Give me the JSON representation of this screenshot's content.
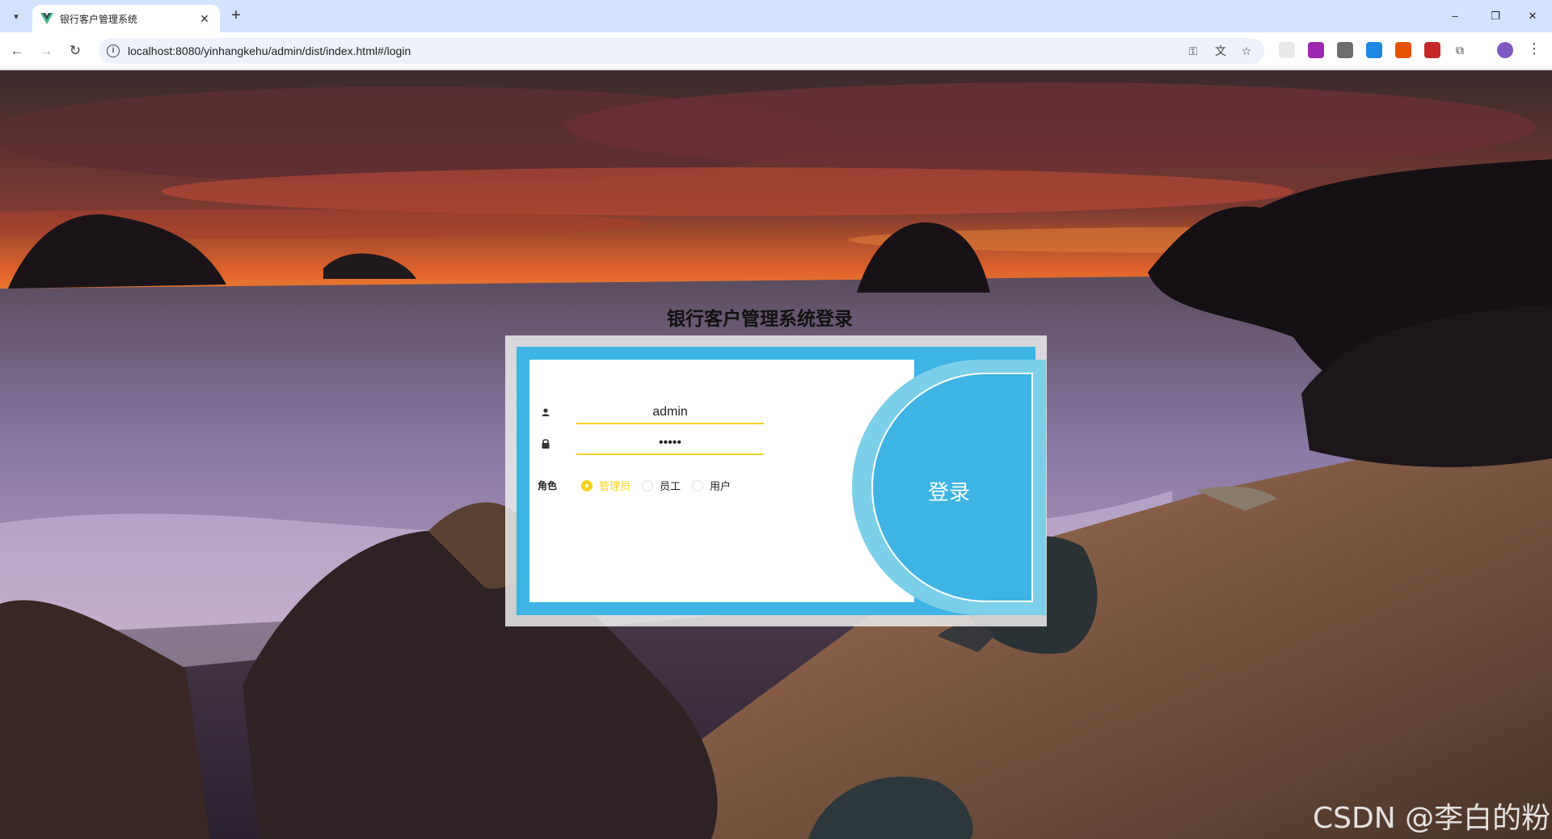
{
  "browser": {
    "tab_title": "银行客户管理系统",
    "url": "localhost:8080/yinhangkehu/admin/dist/index.html#/login",
    "minimize": "–",
    "restore": "❐",
    "close": "✕",
    "new_tab": "+",
    "tab_close": "✕",
    "back": "←",
    "forward": "→",
    "reload": "↻",
    "info": "i",
    "password_key": "⚿",
    "translate": "文",
    "bookmark": "☆",
    "extensions": "⧉",
    "menu": "⋮"
  },
  "page": {
    "title": "银行客户管理系统登录",
    "username_value": "admin",
    "password_value": "•••••",
    "role_label": "角色",
    "roles": [
      "管理员",
      "员工",
      "用户"
    ],
    "selected_role": "管理员",
    "login_button": "登录",
    "watermark": "CSDN @李白的粉"
  },
  "colors": {
    "accent_blue": "#3db4e4",
    "accent_yellow": "#f5d221"
  },
  "icons": {
    "user": "user-icon",
    "lock": "lock-icon"
  }
}
